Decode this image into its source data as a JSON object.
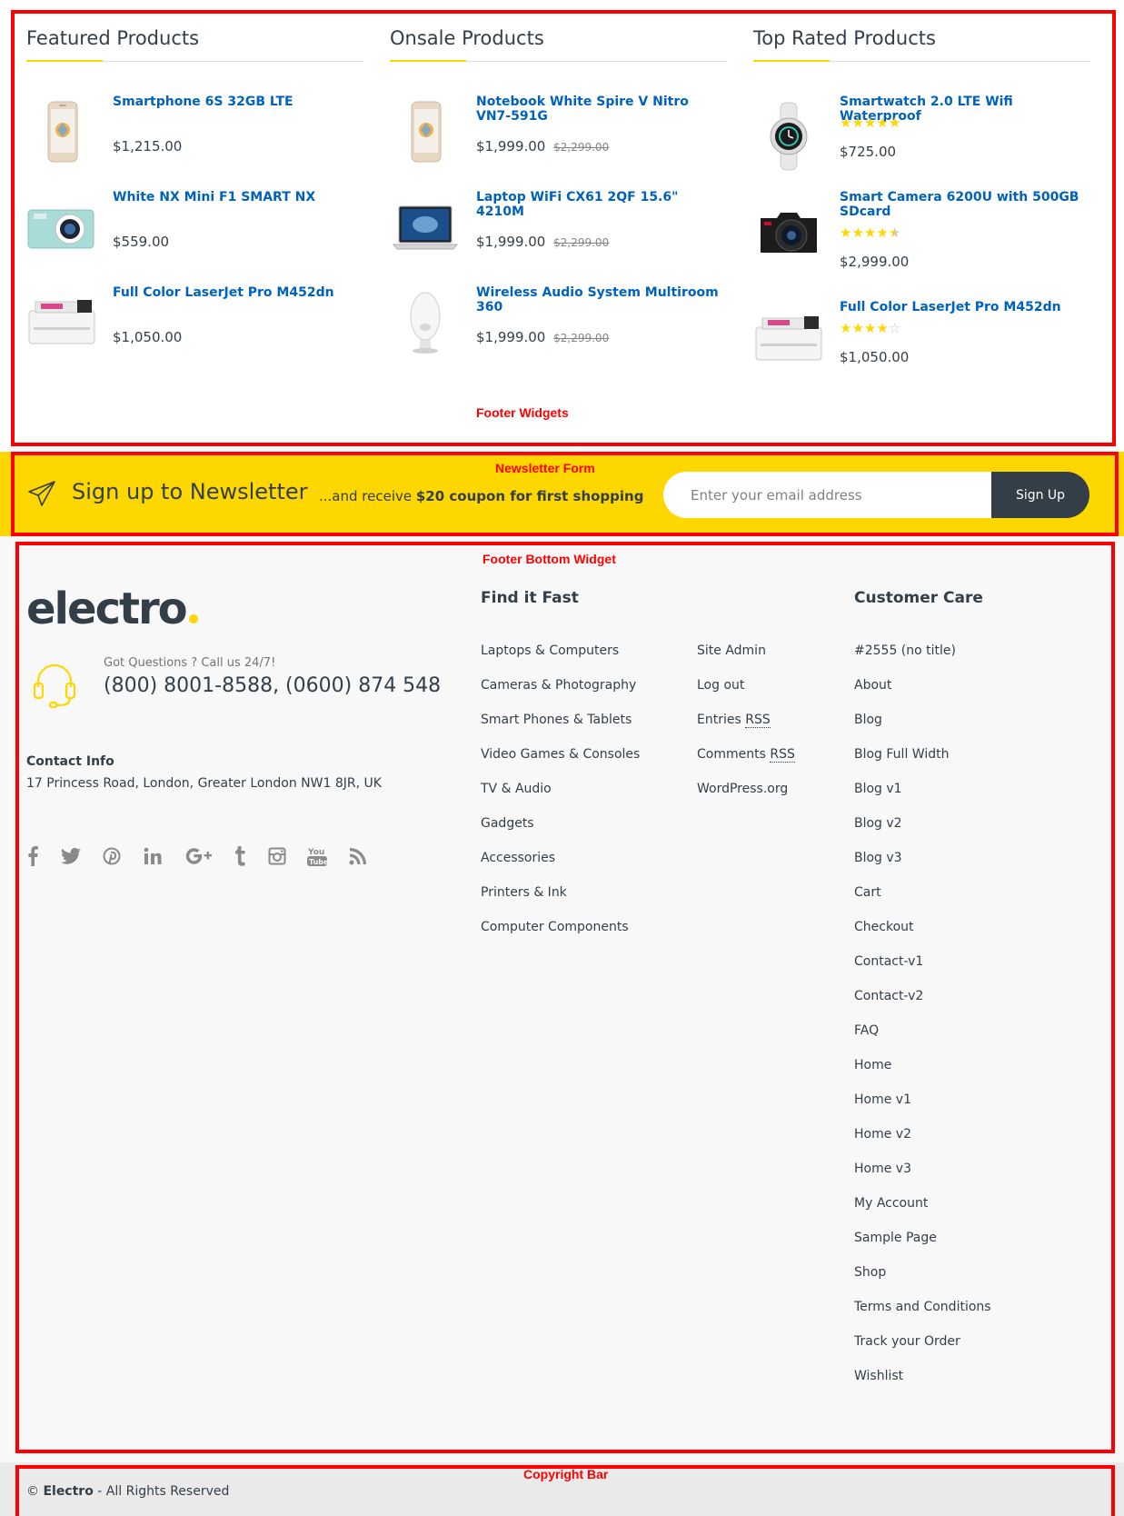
{
  "annotations": {
    "footer_widgets": "Footer Widgets",
    "newsletter_form": "Newsletter Form",
    "footer_bottom_widget": "Footer Bottom Widget",
    "copyright_bar": "Copyright Bar"
  },
  "columns": [
    {
      "title": "Featured Products",
      "products": [
        {
          "name": "Smartphone 6S 32GB LTE",
          "price": "$1,215.00",
          "thumb": "phone-image"
        },
        {
          "name": "White NX Mini F1 SMART NX",
          "price": "$559.00",
          "thumb": "camera-image"
        },
        {
          "name": "Full Color LaserJet Pro M452dn",
          "price": "$1,050.00",
          "thumb": "printer-image"
        }
      ]
    },
    {
      "title": "Onsale Products",
      "products": [
        {
          "name": "Notebook White Spire V Nitro VN7-591G",
          "price": "$1,999.00",
          "old_price": "$2,299.00",
          "thumb": "phone-image"
        },
        {
          "name": "Laptop WiFi CX61 2QF 15.6\" 4210M",
          "price": "$1,999.00",
          "old_price": "$2,299.00",
          "thumb": "laptop-image"
        },
        {
          "name": "Wireless Audio System Multiroom 360",
          "price": "$1,999.00",
          "old_price": "$2,299.00",
          "thumb": "speaker-image"
        }
      ]
    },
    {
      "title": "Top Rated Products",
      "products": [
        {
          "name": "Smartwatch 2.0 LTE Wifi Waterproof",
          "price": "$725.00",
          "rating": 5,
          "thumb": "watch-image"
        },
        {
          "name": "Smart Camera 6200U with 500GB SDcard",
          "price": "$2,999.00",
          "rating": 4.5,
          "thumb": "dslr-image"
        },
        {
          "name": "Full Color LaserJet Pro M452dn",
          "price": "$1,050.00",
          "rating": 4,
          "thumb": "printer-image"
        }
      ]
    }
  ],
  "newsletter": {
    "title": "Sign up to Newsletter",
    "sub_prefix": "...and receive ",
    "sub_bold": "$20 coupon for first shopping",
    "placeholder": "Enter your email address",
    "button": "Sign Up"
  },
  "footer": {
    "logo": "electro",
    "call_small": "Got Questions ? Call us 24/7!",
    "call_big": "(800) 8001-8588, (0600) 874 548",
    "contact_title": "Contact Info",
    "contact_address": "17 Princess Road, London, Greater London NW1 8JR, UK",
    "social_icons": [
      "facebook-icon",
      "twitter-icon",
      "pinterest-icon",
      "linkedin-icon",
      "google-plus-icon",
      "tumblr-icon",
      "instagram-icon",
      "youtube-icon",
      "rss-icon"
    ],
    "find_it_fast": {
      "title": "Find it Fast",
      "links": [
        "Laptops & Computers",
        "Cameras & Photography",
        "Smart Phones & Tablets",
        "Video Games & Consoles",
        "TV & Audio",
        "Gadgets",
        "Accessories",
        "Printers & Ink",
        "Computer Components"
      ]
    },
    "meta_links": [
      {
        "text": "Site Admin"
      },
      {
        "text": "Log out"
      },
      {
        "text": "Entries ",
        "abbr": "RSS"
      },
      {
        "text": "Comments ",
        "abbr": "RSS"
      },
      {
        "text": "WordPress.org"
      }
    ],
    "customer_care": {
      "title": "Customer Care",
      "links": [
        "#2555 (no title)",
        "About",
        "Blog",
        "Blog Full Width",
        "Blog v1",
        "Blog v2",
        "Blog v3",
        "Cart",
        "Checkout",
        "Contact-v1",
        "Contact-v2",
        "FAQ",
        "Home",
        "Home v1",
        "Home v2",
        "Home v3",
        "My Account",
        "Sample Page",
        "Shop",
        "Terms and Conditions",
        "Track your Order",
        "Wishlist"
      ]
    }
  },
  "copyright": {
    "prefix": "© ",
    "brand": "Electro",
    "suffix": " - All Rights Reserved"
  },
  "colors": {
    "accent": "#fed700",
    "link": "#0062bd",
    "text": "#333e48",
    "annotation": "#ff0000"
  }
}
